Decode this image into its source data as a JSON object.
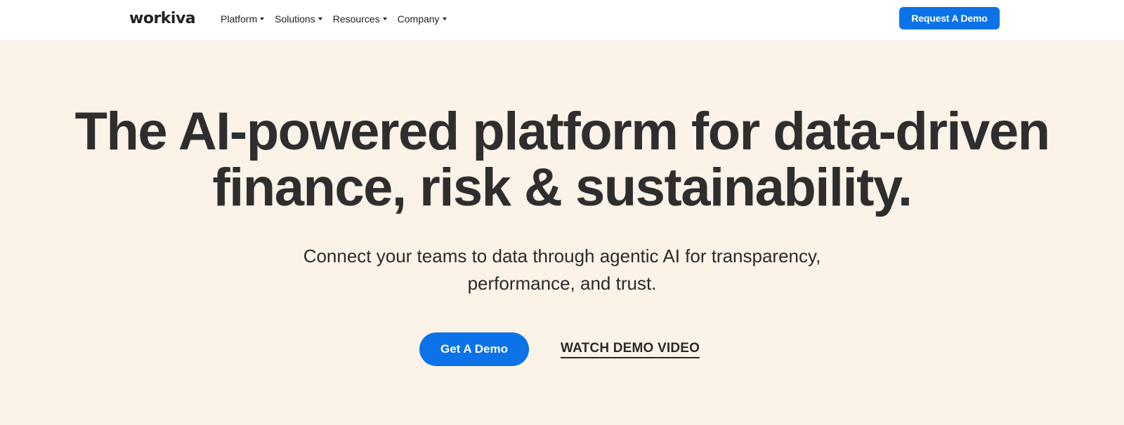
{
  "header": {
    "logo": "workiva",
    "nav": [
      {
        "label": "Platform"
      },
      {
        "label": "Solutions"
      },
      {
        "label": "Resources"
      },
      {
        "label": "Company"
      }
    ],
    "cta": "Request A Demo"
  },
  "hero": {
    "headline_line1": "The AI-powered platform for data-driven",
    "headline_line2": "finance, risk & sustainability.",
    "sub_line1": "Connect your teams to data through agentic AI for transparency,",
    "sub_line2": "performance, and trust.",
    "primary_cta": "Get A Demo",
    "secondary_cta": "WATCH DEMO VIDEO"
  },
  "colors": {
    "accent": "#0b72e7",
    "hero_background": "#fbf2e8",
    "text": "#2e2e2e"
  }
}
